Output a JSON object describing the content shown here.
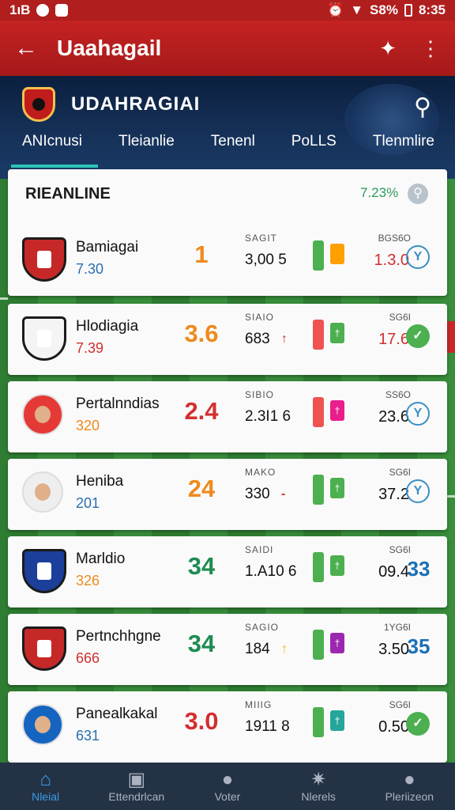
{
  "status_bar": {
    "left_text": "1ıB",
    "battery": "S8%",
    "time": "8:35"
  },
  "appbar": {
    "back_icon": "arrow-left",
    "title": "Uaahagail",
    "action_icons": [
      "jersey-icon",
      "more-vert-icon"
    ]
  },
  "club": {
    "name": "UDAHRAGIAI"
  },
  "tabs": [
    {
      "label": "ANIcnusi"
    },
    {
      "label": "Tleianlie"
    },
    {
      "label": "Tenenl"
    },
    {
      "label": "PoLLS"
    },
    {
      "label": "Tlenmlire"
    }
  ],
  "header_card": {
    "title": "RIEANLINE",
    "value": "7.23%"
  },
  "rows": [
    {
      "name": "Bamiagai",
      "sub": "7.30",
      "sub_color": "#2a6fb0",
      "score": "1",
      "score_color": "#ee8a1c",
      "stat_label": "SAGIT",
      "stat_value": "3,00 5",
      "arrow": "",
      "arrow_color": "#333",
      "bar1": "#4caf50",
      "bar2": "#ffa000",
      "bar2_glyph": "",
      "right_label": "BGS6O",
      "right_value": "1.3.0",
      "right_color": "#d32f2f",
      "end": {
        "kind": "ring",
        "text": "Y"
      },
      "logo": "shield",
      "logo_color": "#c62828"
    },
    {
      "name": "Hlodiagia",
      "sub": "7.39",
      "sub_color": "#d32f2f",
      "score": "3.6",
      "score_color": "#ee8a1c",
      "stat_label": "SIAIO",
      "stat_value": "683",
      "arrow": "↑",
      "arrow_color": "#d32f2f",
      "bar1": "#ef5350",
      "bar2": "#4caf50",
      "bar2_glyph": "†",
      "right_label": "SG6I",
      "right_value": "17.6",
      "right_color": "#d32f2f",
      "end": {
        "kind": "fill",
        "text": "✓"
      },
      "logo": "shield",
      "logo_color": "#f4f4f4"
    },
    {
      "name": "Pertalnndias",
      "sub": "320",
      "sub_color": "#ee8a1c",
      "score": "2.4",
      "score_color": "#d32f2f",
      "stat_label": "SIBIO",
      "stat_value": "2.3I1 6",
      "arrow": "",
      "arrow_color": "#333",
      "bar1": "#ef5350",
      "bar2": "#e91e8c",
      "bar2_glyph": "†",
      "right_label": "SS6O",
      "right_value": "23.6",
      "right_color": "#111",
      "end": {
        "kind": "ring",
        "text": "Y"
      },
      "logo": "photo",
      "logo_color": "#e53935"
    },
    {
      "name": "Heniba",
      "sub": "201",
      "sub_color": "#2a6fb0",
      "score": "24",
      "score_color": "#ee8a1c",
      "stat_label": "MAKO",
      "stat_value": "330",
      "arrow": "-",
      "arrow_color": "#d32f2f",
      "bar1": "#4caf50",
      "bar2": "#4caf50",
      "bar2_glyph": "†",
      "right_label": "SG6I",
      "right_value": "37.2",
      "right_color": "#111",
      "end": {
        "kind": "ring",
        "text": "Y"
      },
      "logo": "photo",
      "logo_color": "#eeeeee"
    },
    {
      "name": "Marldio",
      "sub": "326",
      "sub_color": "#ee8a1c",
      "score": "34",
      "score_color": "#1e8c52",
      "stat_label": "SAIDI",
      "stat_value": "1.A10 6",
      "arrow": "",
      "arrow_color": "#333",
      "bar1": "#4caf50",
      "bar2": "#4caf50",
      "bar2_glyph": "†",
      "right_label": "SG6I",
      "right_value": "09.4",
      "right_color": "#111",
      "end": {
        "kind": "num",
        "text": "33"
      },
      "logo": "shield",
      "logo_color": "#1b3f9a"
    },
    {
      "name": "Pertnchhgne",
      "sub": "666",
      "sub_color": "#d32f2f",
      "score": "34",
      "score_color": "#1e8c52",
      "stat_label": "SAGIO",
      "stat_value": "184",
      "arrow": "↑",
      "arrow_color": "#f0b400",
      "bar1": "#4caf50",
      "bar2": "#9c27b0",
      "bar2_glyph": "†",
      "right_label": "1YG6I",
      "right_value": "3.50",
      "right_color": "#111",
      "end": {
        "kind": "num",
        "text": "35"
      },
      "logo": "shield",
      "logo_color": "#c62828"
    },
    {
      "name": "Panealkakal",
      "sub": "631",
      "sub_color": "#2a6fb0",
      "score": "3.0",
      "score_color": "#d32f2f",
      "stat_label": "MIIIG",
      "stat_value": "1911 8",
      "arrow": "",
      "arrow_color": "#333",
      "bar1": "#4caf50",
      "bar2": "#26a69a",
      "bar2_glyph": "†",
      "right_label": "SG6I",
      "right_value": "0.50",
      "right_color": "#111",
      "end": {
        "kind": "fill",
        "text": "✓"
      },
      "logo": "photo",
      "logo_color": "#1565c0"
    }
  ],
  "bottom_nav": [
    {
      "label": "Nleial",
      "icon": "home-icon",
      "glyph": "⌂",
      "active": true
    },
    {
      "label": "Ettendrlcan",
      "icon": "chat-icon",
      "glyph": "▣",
      "active": false
    },
    {
      "label": "Voter",
      "icon": "ball-icon",
      "glyph": "●",
      "active": false
    },
    {
      "label": "Nlerels",
      "icon": "award-icon",
      "glyph": "✷",
      "active": false
    },
    {
      "label": "Pleriizeon",
      "icon": "profile-icon",
      "glyph": "●",
      "active": false
    }
  ]
}
